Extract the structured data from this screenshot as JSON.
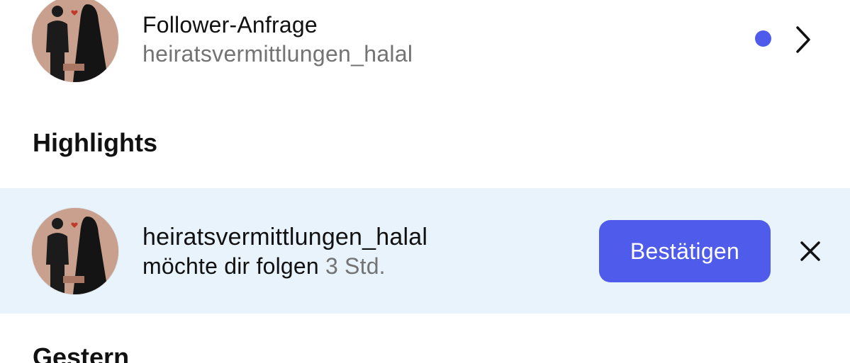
{
  "follower_request": {
    "title": "Follower-Anfrage",
    "username": "heiratsvermittlungen_halal",
    "unread_dot_color": "#4f5bea",
    "avatar_icon": "couple-avatar-icon",
    "chevron_icon": "chevron-right-icon"
  },
  "sections": {
    "highlights": "Highlights",
    "gestern": "Gestern"
  },
  "highlight_item": {
    "username": "heiratsvermittlungen_halal",
    "message": "möchte dir folgen",
    "time": "3 Std.",
    "confirm_label": "Bestätigen",
    "dismiss_icon": "close-icon",
    "background_color": "#e9f3fc",
    "button_color": "#4f5bea"
  }
}
